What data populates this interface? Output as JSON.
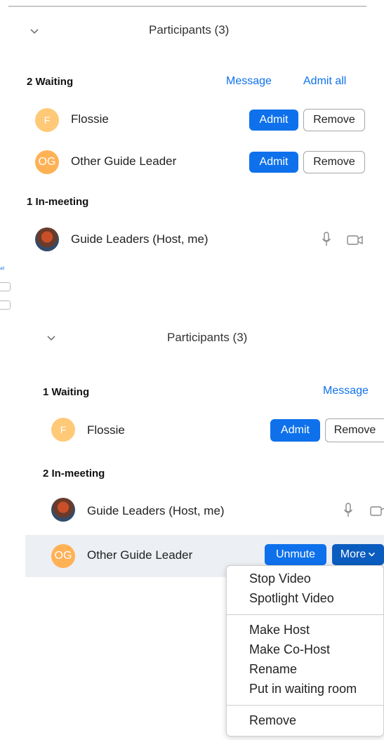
{
  "panel_a": {
    "title": "Participants (3)",
    "waiting_header": "2 Waiting",
    "message_link": "Message",
    "admit_all_link": "Admit all",
    "waiting": [
      {
        "initials": "F",
        "name": "Flossie",
        "admit": "Admit",
        "remove": "Remove"
      },
      {
        "initials": "OG",
        "name": "Other Guide Leader",
        "admit": "Admit",
        "remove": "Remove"
      }
    ],
    "inmeeting_header": "1 In-meeting",
    "inmeeting": [
      {
        "name": "Guide Leaders (Host, me)"
      }
    ]
  },
  "panel_b": {
    "title": "Participants (3)",
    "waiting_header": "1 Waiting",
    "message_link": "Message",
    "waiting": [
      {
        "initials": "F",
        "name": "Flossie",
        "admit": "Admit",
        "remove": "Remove"
      }
    ],
    "inmeeting_header": "2 In-meeting",
    "inmeeting": [
      {
        "name": "Guide Leaders (Host, me)"
      },
      {
        "initials": "OG",
        "name": "Other Guide Leader",
        "unmute": "Unmute",
        "more": "More"
      }
    ]
  },
  "more_menu": {
    "group1": [
      "Stop Video",
      "Spotlight Video"
    ],
    "group2": [
      "Make Host",
      "Make Co-Host",
      "Rename",
      "Put in waiting room"
    ],
    "group3": [
      "Remove"
    ]
  },
  "colors": {
    "accent": "#0e71eb",
    "avatar_f": "#ffc978",
    "avatar_og": "#ffb156",
    "highlight_row": "#eceff3"
  },
  "icons": [
    "chevron-down-icon",
    "microphone-icon",
    "video-camera-icon"
  ]
}
